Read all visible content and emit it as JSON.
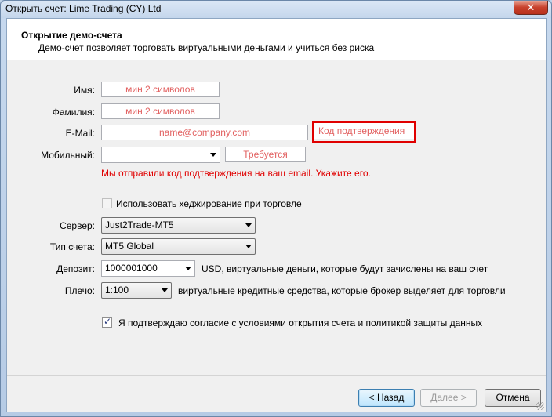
{
  "window": {
    "title": "Открыть счет: Lime Trading (CY) Ltd",
    "close_glyph": "✕"
  },
  "header": {
    "title": "Открытие демо-счета",
    "subtitle": "Демо-счет позволяет торговать виртуальными деньгами и учиться без риска"
  },
  "form": {
    "first_name": {
      "label": "Имя:",
      "placeholder": "мин 2 символов"
    },
    "last_name": {
      "label": "Фамилия:",
      "placeholder": "мин 2 символов"
    },
    "email": {
      "label": "E-Mail:",
      "placeholder": "name@company.com"
    },
    "code": {
      "placeholder": "Код подтверждения"
    },
    "mobile": {
      "label": "Мобильный:",
      "value": "",
      "required_placeholder": "Требуется"
    },
    "error_message": "Мы отправили код подтверждения на ваш email. Укажите его.",
    "hedging": {
      "label": "Использовать хеджирование при торговле",
      "checked": false,
      "enabled": false
    },
    "server": {
      "label": "Сервер:",
      "value": "Just2Trade-MT5"
    },
    "account_type": {
      "label": "Тип счета:",
      "value": "MT5 Global"
    },
    "deposit": {
      "label": "Депозит:",
      "value": "1000001000",
      "note": "USD, виртуальные деньги, которые будут зачислены на ваш счет"
    },
    "leverage": {
      "label": "Плечо:",
      "value": "1:100",
      "note": "виртуальные кредитные средства, которые брокер выделяет для торговли"
    },
    "agreement": {
      "label": "Я подтверждаю согласие с условиями открытия счета и политикой защиты данных",
      "checked": true
    }
  },
  "buttons": {
    "back": "< Назад",
    "next": "Далее >",
    "cancel": "Отмена"
  },
  "colors": {
    "highlight": "#e00000",
    "error": "#e00000",
    "placeholder": "#e26060"
  }
}
